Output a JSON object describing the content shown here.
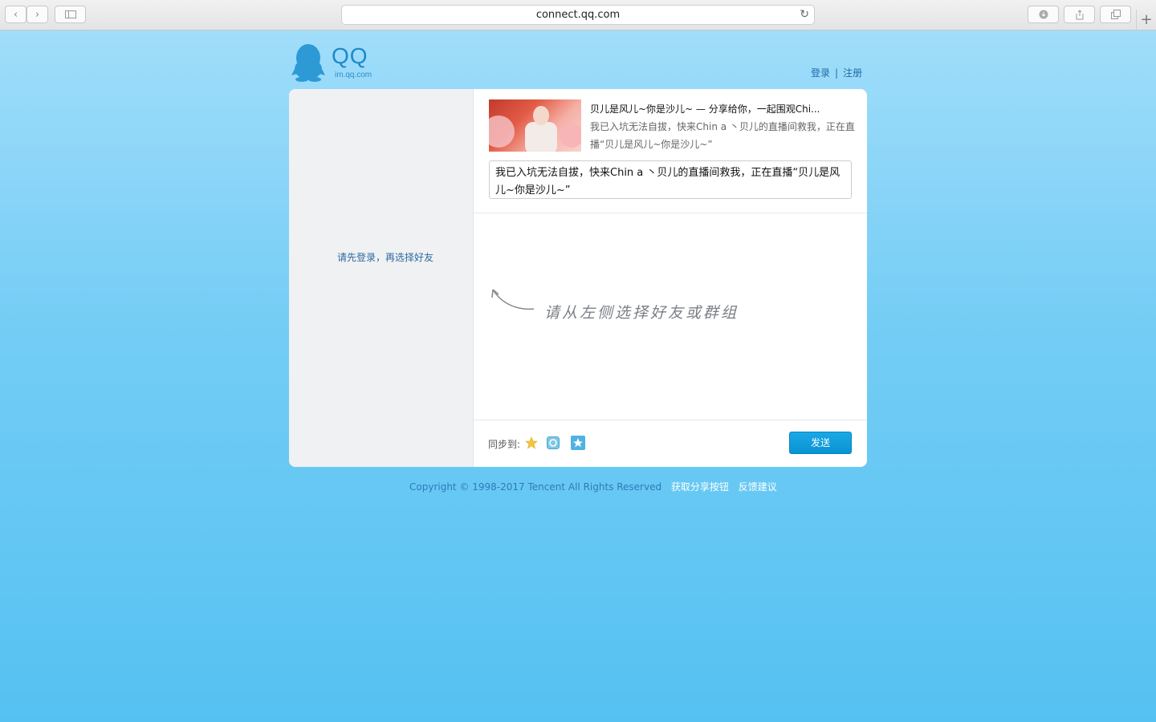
{
  "browser": {
    "url": "connect.qq.com",
    "icons": [
      "back-icon",
      "forward-icon",
      "sidebar-icon",
      "reload-icon",
      "download-icon",
      "share-icon",
      "tabs-icon",
      "new-tab-icon"
    ]
  },
  "header": {
    "logo_text": "QQ",
    "logo_sub": "im.qq.com",
    "login": "登录",
    "separator": "|",
    "register": "注册"
  },
  "left": {
    "message": "请先登录，再选择好友"
  },
  "share": {
    "title": "贝儿是风儿~你是沙儿~ — 分享给你，一起围观Chi...",
    "description": "我已入坑无法自拔，快来Chin a 丶贝儿的直播间救我，正在直播“贝儿是风儿~你是沙儿~”",
    "message": "我已入坑无法自拔，快来Chin a 丶贝儿的直播间救我，正在直播“贝儿是风儿~你是沙儿~”"
  },
  "hint": {
    "text": "请从左侧选择好友或群组"
  },
  "footer_bar": {
    "sync_label": "同步到:",
    "send_label": "发送"
  },
  "footer": {
    "copyright": "Copyright © 1998-2017 Tencent All Rights Reserved",
    "link1": "获取分享按钮",
    "link2": "反馈建议"
  },
  "colors": {
    "accent": "#0b93d4",
    "link": "#1f6aa6",
    "background": "#74cdf5"
  }
}
